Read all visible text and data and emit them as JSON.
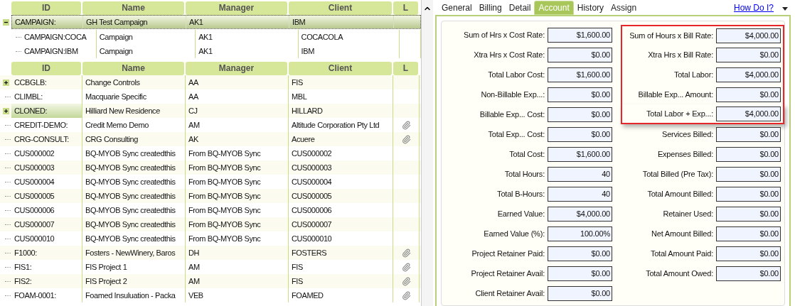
{
  "campaign_table": {
    "columns": [
      "ID",
      "Name",
      "Manager",
      "Client",
      "L"
    ],
    "rows": [
      {
        "id": "CAMPAIGN:",
        "name": "GH Test Campaign",
        "manager": "AK1",
        "client": "IBM",
        "expanded": true,
        "selected": true,
        "children": [
          {
            "id": "CAMPAIGN:COCA",
            "name": "Campaign",
            "manager": "AK1",
            "client": "COCACOLA"
          },
          {
            "id": "CAMPAIGN:IBM",
            "name": "Campaign",
            "manager": "AK1",
            "client": "IBM"
          }
        ]
      }
    ]
  },
  "project_table": {
    "columns": [
      "ID",
      "Name",
      "Manager",
      "Client",
      "L"
    ],
    "rows": [
      {
        "id": "CCBGLB:",
        "name": "Change Controls",
        "manager": "AA",
        "client": "FIS",
        "expandable": true,
        "hovered": false,
        "attachment": false
      },
      {
        "id": "CLIMBL:",
        "name": "Macquarie Specific",
        "manager": "AA",
        "client": "MBL",
        "expandable": false,
        "hovered": false,
        "attachment": false
      },
      {
        "id": "CLONED:",
        "name": "Hilliard New Residence",
        "manager": "CJ",
        "client": "HILLARD",
        "expandable": true,
        "hovered": true,
        "attachment": false
      },
      {
        "id": "CREDIT-DEMO:",
        "name": "Credit Memo Demo",
        "manager": "AM",
        "client": "Altitude Corporation Pty Ltd",
        "expandable": false,
        "hovered": false,
        "attachment": true
      },
      {
        "id": "CRG-CONSULT:",
        "name": "CRG Consulting",
        "manager": "AK",
        "client": "Acuere",
        "expandable": false,
        "hovered": false,
        "attachment": true
      },
      {
        "id": "CUS000002",
        "name": "BQ-MYOB Sync createdthis",
        "manager": "From BQ-MYOB Sync",
        "client": "CUS000002",
        "expandable": false,
        "hovered": false,
        "attachment": false
      },
      {
        "id": "CUS000003",
        "name": "BQ-MYOB Sync createdthis",
        "manager": "From BQ-MYOB Sync",
        "client": "CUS000003",
        "expandable": false,
        "hovered": false,
        "attachment": false
      },
      {
        "id": "CUS000004",
        "name": "BQ-MYOB Sync createdthis",
        "manager": "From BQ-MYOB Sync",
        "client": "CUS000004",
        "expandable": false,
        "hovered": false,
        "attachment": false
      },
      {
        "id": "CUS000005",
        "name": "BQ-MYOB Sync createdthis",
        "manager": "From BQ-MYOB Sync",
        "client": "CUS000005",
        "expandable": false,
        "hovered": false,
        "attachment": false
      },
      {
        "id": "CUS000006",
        "name": "BQ-MYOB Sync createdthis",
        "manager": "From BQ-MYOB Sync",
        "client": "CUS000006",
        "expandable": false,
        "hovered": false,
        "attachment": false
      },
      {
        "id": "CUS000007",
        "name": "BQ-MYOB Sync createdthis",
        "manager": "From BQ-MYOB Sync",
        "client": "CUS000007",
        "expandable": false,
        "hovered": false,
        "attachment": false
      },
      {
        "id": "CUS000010",
        "name": "BQ-MYOB Sync createdthis",
        "manager": "From BQ-MYOB Sync",
        "client": "CUS000010",
        "expandable": false,
        "hovered": false,
        "attachment": false
      },
      {
        "id": "F1000:",
        "name": "Fosters - NewWinery, Baros",
        "manager": "DH",
        "client": "FOSTERS",
        "expandable": false,
        "hovered": false,
        "attachment": true
      },
      {
        "id": "FIS1:",
        "name": "FIS Project 1",
        "manager": "AM",
        "client": "FIS",
        "expandable": false,
        "hovered": false,
        "attachment": true
      },
      {
        "id": "FIS2:",
        "name": "FIS Project 2",
        "manager": "AM",
        "client": "FIS",
        "expandable": false,
        "hovered": false,
        "attachment": true
      },
      {
        "id": "FOAM-0001:",
        "name": "Foamed Insuluation - Packa",
        "manager": "VEB",
        "client": "FOAMED",
        "expandable": false,
        "hovered": false,
        "attachment": true
      }
    ]
  },
  "tabs": [
    {
      "label": "General",
      "selected": false
    },
    {
      "label": "Billing",
      "selected": false
    },
    {
      "label": "Detail",
      "selected": false
    },
    {
      "label": "Account",
      "selected": true
    },
    {
      "label": "History",
      "selected": false
    },
    {
      "label": "Assign",
      "selected": false
    }
  ],
  "help_link": "How Do I?",
  "account": {
    "left_fields": [
      {
        "label": "Sum of Hrs x Cost Rate:",
        "value": "$1,600.00"
      },
      {
        "label": "Xtra Hrs x Cost Rate:",
        "value": "$0.00"
      },
      {
        "label": "Total Labor Cost:",
        "value": "$1,600.00"
      },
      {
        "label": "Non-Billable Exp...:",
        "value": "$0.00"
      },
      {
        "label": "Billable Exp... Cost:",
        "value": "$0.00"
      },
      {
        "label": "Total Exp... Cost:",
        "value": "$0.00"
      },
      {
        "label": "Total Cost:",
        "value": "$1,600.00"
      },
      {
        "label": "Total Hours:",
        "value": "40"
      },
      {
        "label": "Total B-Hours:",
        "value": "40"
      },
      {
        "label": "Earned Value:",
        "value": "$4,000.00"
      },
      {
        "label": "Earned Value (%):",
        "value": "100.00%"
      },
      {
        "label": "Project Retainer Paid:",
        "value": "$0.00"
      },
      {
        "label": "Project Retainer Avail:",
        "value": "$0.00"
      },
      {
        "label": "Client Retainer Avail:",
        "value": "$0.00"
      }
    ],
    "right_fields": [
      {
        "label": "Sum of Hours x Bill Rate:",
        "value": "$4,000.00",
        "highlighted": true
      },
      {
        "label": "Xtra Hrs x Bill Rate:",
        "value": "$0.00",
        "highlighted": true
      },
      {
        "label": "Total Labor:",
        "value": "$4,000.00",
        "highlighted": true
      },
      {
        "label": "Billable Exp... Amount:",
        "value": "$0.00",
        "highlighted": true
      },
      {
        "label": "Total Labor + Exp...:",
        "value": "$4,000.00",
        "highlighted": true
      },
      {
        "label": "Services Billed:",
        "value": "$0.00",
        "highlighted": false
      },
      {
        "label": "Expenses Billed:",
        "value": "$0.00",
        "highlighted": false
      },
      {
        "label": "Total Billed (Pre Tax):",
        "value": "$0.00",
        "highlighted": false
      },
      {
        "label": "Total Amount Billed:",
        "value": "$0.00",
        "highlighted": false
      },
      {
        "label": "Retainer Used:",
        "value": "$0.00",
        "highlighted": false
      },
      {
        "label": "Net Amount Billed:",
        "value": "$0.00",
        "highlighted": false
      },
      {
        "label": "Total Amount Paid:",
        "value": "$0.00",
        "highlighted": false
      },
      {
        "label": "Total Amount Owed:",
        "value": "$0.00",
        "highlighted": false
      }
    ]
  }
}
